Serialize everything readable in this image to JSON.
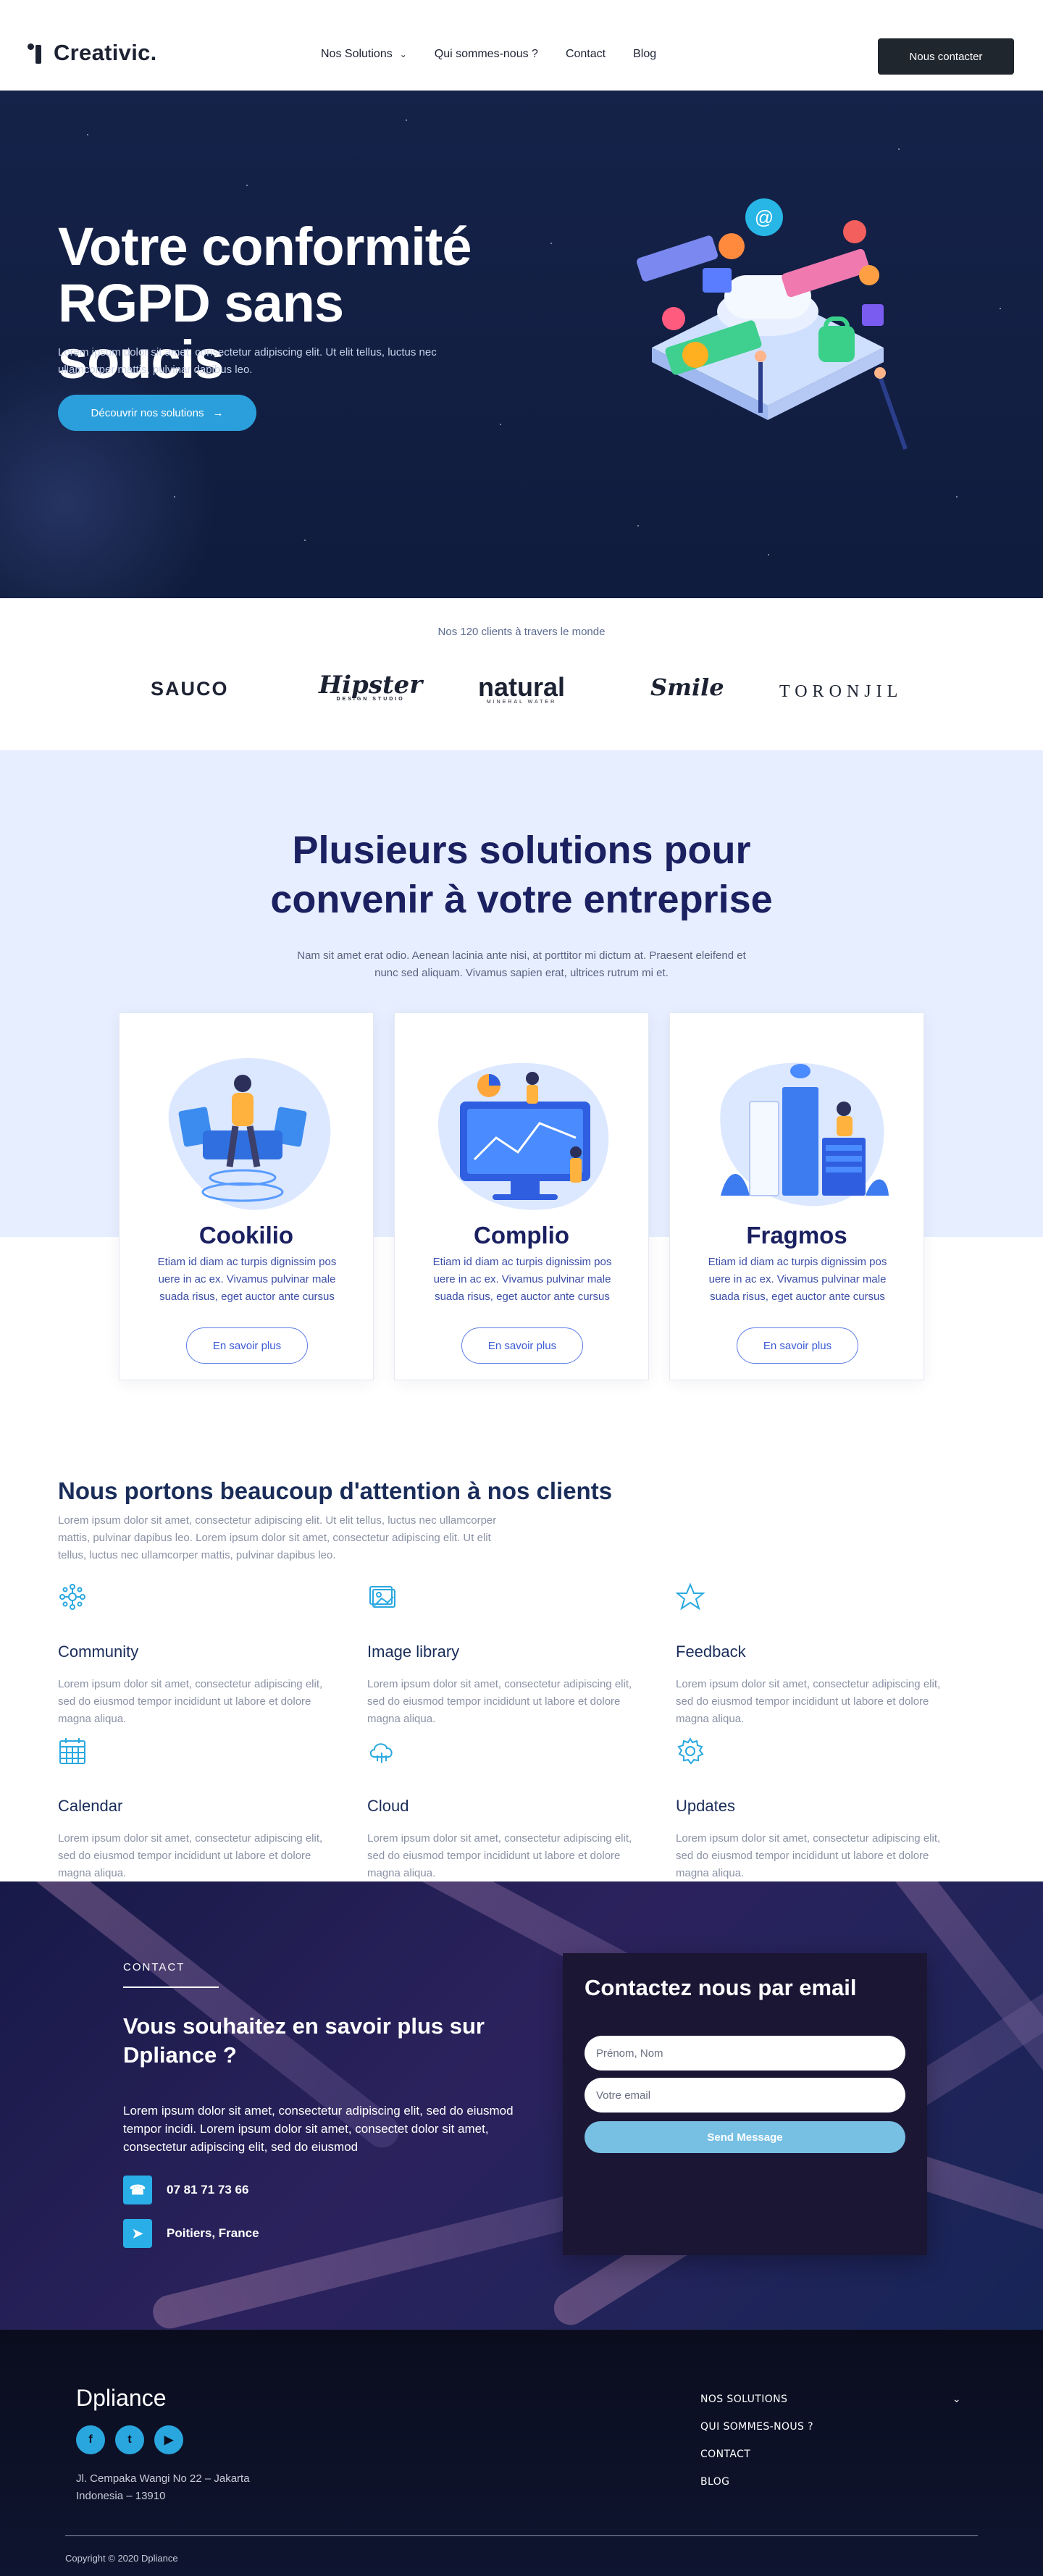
{
  "nav": {
    "logo": "Creativic.",
    "items": [
      {
        "label": "Nos Solutions",
        "chevron": "⌄"
      },
      {
        "label": "Qui sommes-nous ?"
      },
      {
        "label": "Contact"
      },
      {
        "label": "Blog"
      }
    ],
    "cta": "Nous contacter"
  },
  "hero": {
    "title": "Votre conformité RGPD sans soucis",
    "subtitle": "Lorem ipsum dolor sit amet, consectetur adipiscing elit. Ut elit tellus, luctus nec ullamcorper mattis, pulvinar dapibus leo.",
    "button": "Découvrir nos solutions",
    "button_arrow": "→"
  },
  "clients": {
    "title": "Nos 120 clients à travers le monde",
    "logos": [
      "SAUCO",
      "Hipster",
      "natural",
      "Smile",
      "TORONJIL"
    ],
    "logo_subs": [
      "DESIGN STUDIO",
      "MINERAL WATER"
    ]
  },
  "solutions": {
    "title_line1": "Plusieurs solutions pour",
    "title_line2": "convenir à votre entreprise",
    "subtitle": "Nam sit amet erat odio. Aenean lacinia ante nisi, at porttitor mi dictum at. Praesent eleifend et nunc sed aliquam. Vivamus sapien erat, ultrices rutrum mi et.",
    "cards": [
      {
        "title": "Cookilio",
        "text": "Etiam id diam ac turpis dignissim pos uere in ac ex. Vivamus pulvinar male suada risus, eget auctor ante cursus",
        "button": "En savoir plus"
      },
      {
        "title": "Complio",
        "text": "Etiam id diam ac turpis dignissim pos uere in ac ex. Vivamus pulvinar male suada risus, eget auctor ante cursus",
        "button": "En savoir plus"
      },
      {
        "title": "Fragmos",
        "text": "Etiam id diam ac turpis dignissim pos uere in ac ex. Vivamus pulvinar male suada risus, eget auctor ante cursus",
        "button": "En savoir plus"
      }
    ]
  },
  "features": {
    "title": "Nous portons beaucoup d'attention à nos clients",
    "subtitle": "Lorem ipsum dolor sit amet, consectetur adipiscing elit. Ut elit tellus, luctus nec ullamcorper mattis, pulvinar dapibus leo. Lorem ipsum dolor sit amet, consectetur adipiscing elit. Ut elit tellus, luctus nec ullamcorper mattis, pulvinar dapibus leo.",
    "items": [
      {
        "icon": "community-icon",
        "name": "Community",
        "text": "Lorem ipsum dolor sit amet, consectetur adipiscing elit, sed do eiusmod tempor incididunt ut labore et dolore magna aliqua."
      },
      {
        "icon": "image-library-icon",
        "name": "Image library",
        "text": "Lorem ipsum dolor sit amet, consectetur adipiscing elit, sed do eiusmod tempor incididunt ut labore et dolore magna aliqua."
      },
      {
        "icon": "star-icon",
        "name": "Feedback",
        "text": "Lorem ipsum dolor sit amet, consectetur adipiscing elit, sed do eiusmod tempor incididunt ut labore et dolore magna aliqua."
      },
      {
        "icon": "calendar-icon",
        "name": "Calendar",
        "text": "Lorem ipsum dolor sit amet, consectetur adipiscing elit, sed do eiusmod tempor incididunt ut labore et dolore magna aliqua."
      },
      {
        "icon": "cloud-icon",
        "name": "Cloud",
        "text": "Lorem ipsum dolor sit amet, consectetur adipiscing elit, sed do eiusmod tempor incididunt ut labore et dolore magna aliqua."
      },
      {
        "icon": "gear-icon",
        "name": "Updates",
        "text": "Lorem ipsum dolor sit amet, consectetur adipiscing elit, sed do eiusmod tempor incididunt ut labore et dolore magna aliqua."
      }
    ]
  },
  "contact": {
    "kicker": "CONTACT",
    "title": "Vous souhaitez en savoir plus sur Dpliance ?",
    "text": "Lorem ipsum dolor sit amet, consectetur adipiscing elit, sed do eiusmod tempor incidi. Lorem ipsum dolor sit amet, consectet dolor sit amet, consectetur adipiscing elit, sed do eiusmod",
    "phone": "07 81 71 73 66",
    "location": "Poitiers, France",
    "form": {
      "title": "Contactez nous par email",
      "name_placeholder": "Prénom, Nom",
      "email_placeholder": "Votre email",
      "submit": "Send Message"
    }
  },
  "footer": {
    "brand": "Dpliance",
    "address": "Jl. Cempaka Wangi No 22 – Jakarta Indonesia – 13910",
    "menu": [
      {
        "label": "NOS SOLUTIONS",
        "chevron": "⌄"
      },
      {
        "label": "QUI SOMMES-NOUS ?"
      },
      {
        "label": "CONTACT"
      },
      {
        "label": "BLOG"
      }
    ],
    "copyright": "Copyright © 2020 Dpliance"
  },
  "colors": {
    "hero_bg": "#152249",
    "accent": "#2b9fdb",
    "heading": "#1a2060",
    "solutions_bg": "#e6eeff",
    "footer_bg": "#0b0d1e"
  }
}
